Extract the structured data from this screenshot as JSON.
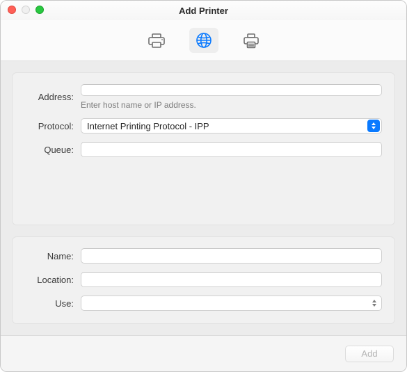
{
  "window": {
    "title": "Add Printer"
  },
  "toolbar": {
    "tabs": [
      {
        "name": "default",
        "selected": false
      },
      {
        "name": "ip",
        "selected": true
      },
      {
        "name": "windows",
        "selected": false
      }
    ]
  },
  "fields": {
    "address": {
      "label": "Address:",
      "value": "",
      "hint": "Enter host name or IP address."
    },
    "protocol": {
      "label": "Protocol:",
      "value": "Internet Printing Protocol - IPP"
    },
    "queue": {
      "label": "Queue:",
      "value": ""
    },
    "name": {
      "label": "Name:",
      "value": ""
    },
    "location": {
      "label": "Location:",
      "value": ""
    },
    "use": {
      "label": "Use:",
      "value": ""
    }
  },
  "footer": {
    "add_label": "Add",
    "add_enabled": false
  }
}
